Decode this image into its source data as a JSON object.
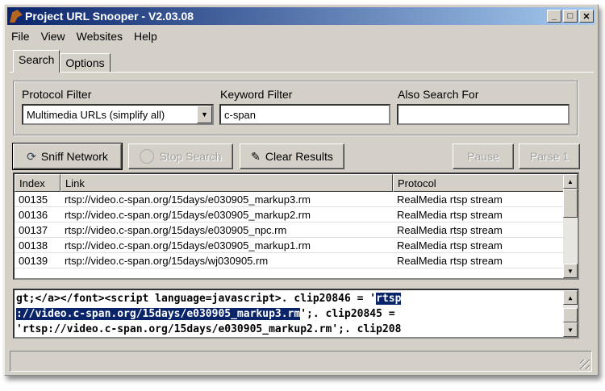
{
  "window": {
    "title": "Project URL Snooper - V2.03.08",
    "minimize": "_",
    "maximize": "□",
    "close": "✕"
  },
  "menu": [
    "File",
    "View",
    "Websites",
    "Help"
  ],
  "tabs": [
    "Search",
    "Options"
  ],
  "filters": {
    "protocol_label": "Protocol Filter",
    "protocol_value": "Multimedia URLs (simplify all)",
    "keyword_label": "Keyword Filter",
    "keyword_value": "c-span",
    "also_label": "Also Search For",
    "also_value": ""
  },
  "buttons": {
    "sniff": "Sniff Network",
    "stop": "Stop Search",
    "clear": "Clear Results",
    "pause": "Pause",
    "parse": "Parse 1"
  },
  "table": {
    "headers": [
      "Index",
      "Link",
      "Protocol"
    ],
    "rows": [
      [
        "00135",
        "rtsp://video.c-span.org/15days/e030905_markup3.rm",
        "RealMedia rtsp stream"
      ],
      [
        "00136",
        "rtsp://video.c-span.org/15days/e030905_markup2.rm",
        "RealMedia rtsp stream"
      ],
      [
        "00137",
        "rtsp://video.c-span.org/15days/e030905_npc.rm",
        "RealMedia rtsp stream"
      ],
      [
        "00138",
        "rtsp://video.c-span.org/15days/e030905_markup1.rm",
        "RealMedia rtsp stream"
      ],
      [
        "00139",
        "rtsp://video.c-span.org/15days/wj030905.rm",
        "RealMedia rtsp stream"
      ]
    ]
  },
  "source": {
    "line1_pre": "gt;</a></font><script language=javascript>.   clip20846 = '",
    "line1_sel": "rtsp",
    "line2_sel": "://video.c-span.org/15days/e030905_markup3.rm",
    "line2_post": "';.   clip20845 =",
    "line3": "'rtsp://video.c-span.org/15days/e030905_markup2.rm';.   clip208"
  },
  "colors": {
    "titlebar": "#0a246a",
    "selection": "#0a246a",
    "face": "#d4d0c8"
  }
}
